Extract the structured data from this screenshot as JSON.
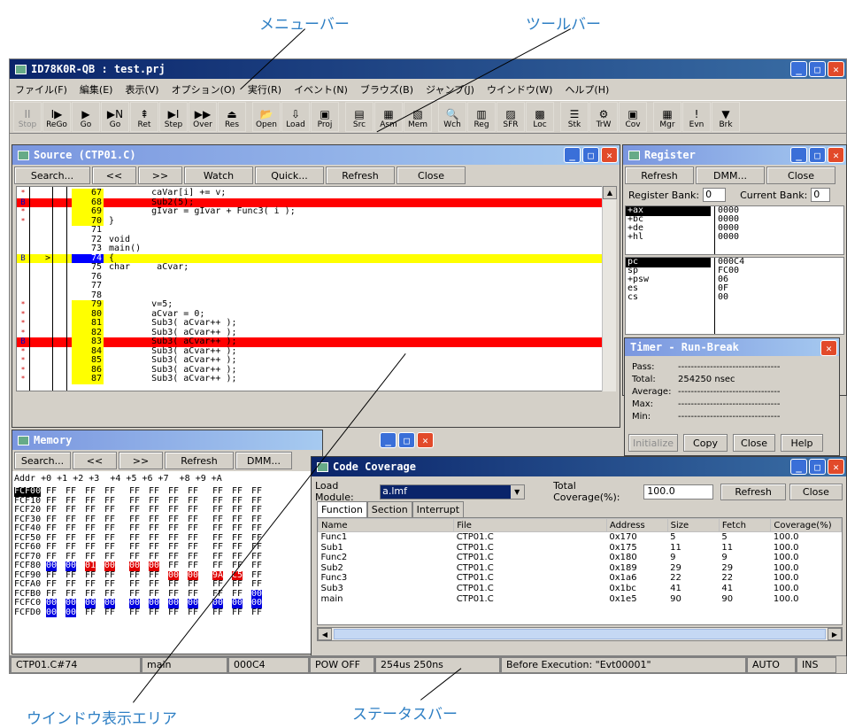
{
  "callouts": {
    "menubar": "メニューバー",
    "toolbar": "ツールバー",
    "window_area": "ウインドウ表示エリア",
    "statusbar": "ステータスバー"
  },
  "app": {
    "title": "ID78K0R-QB : test.prj"
  },
  "menu": [
    "ファイル(F)",
    "編集(E)",
    "表示(V)",
    "オプション(O)",
    "実行(R)",
    "イベント(N)",
    "ブラウズ(B)",
    "ジャンプ(J)",
    "ウインドウ(W)",
    "ヘルプ(H)"
  ],
  "toolbar": [
    {
      "label": "Stop",
      "icon": "stop-icon",
      "glyph": "II",
      "disabled": true
    },
    {
      "label": "ReGo",
      "icon": "rego-icon",
      "glyph": "I▶",
      "disabled": false
    },
    {
      "label": "Go",
      "icon": "go-icon",
      "glyph": "▶",
      "disabled": false
    },
    {
      "label": "Go",
      "icon": "go-n-icon",
      "glyph": "▶N",
      "disabled": false
    },
    {
      "label": "Ret",
      "icon": "ret-icon",
      "glyph": "⇞",
      "disabled": false
    },
    {
      "label": "Step",
      "icon": "step-icon",
      "glyph": "▶I",
      "disabled": false
    },
    {
      "label": "Over",
      "icon": "over-icon",
      "glyph": "▶▶",
      "disabled": false
    },
    {
      "label": "Res",
      "icon": "reset-icon",
      "glyph": "⏏",
      "disabled": false
    },
    {
      "sep": true
    },
    {
      "label": "Open",
      "icon": "open-icon",
      "glyph": "📂",
      "disabled": false
    },
    {
      "label": "Load",
      "icon": "load-icon",
      "glyph": "⇩",
      "disabled": false
    },
    {
      "label": "Proj",
      "icon": "project-icon",
      "glyph": "▣",
      "disabled": false
    },
    {
      "sep": true
    },
    {
      "label": "Src",
      "icon": "source-icon",
      "glyph": "▤",
      "disabled": false
    },
    {
      "label": "Asm",
      "icon": "asm-icon",
      "glyph": "▦",
      "disabled": false
    },
    {
      "label": "Mem",
      "icon": "memory-icon",
      "glyph": "▧",
      "disabled": false
    },
    {
      "sep": true
    },
    {
      "label": "Wch",
      "icon": "watch-icon",
      "glyph": "🔍",
      "disabled": false
    },
    {
      "label": "Reg",
      "icon": "register-icon",
      "glyph": "▥",
      "disabled": false
    },
    {
      "label": "SFR",
      "icon": "sfr-icon",
      "glyph": "▨",
      "disabled": false
    },
    {
      "label": "Loc",
      "icon": "local-icon",
      "glyph": "▩",
      "disabled": false
    },
    {
      "sep": true
    },
    {
      "label": "Stk",
      "icon": "stack-icon",
      "glyph": "☰",
      "disabled": false
    },
    {
      "label": "TrW",
      "icon": "trace-icon",
      "glyph": "⚙",
      "disabled": false
    },
    {
      "label": "Cov",
      "icon": "coverage-icon",
      "glyph": "▣",
      "disabled": false
    },
    {
      "sep": true
    },
    {
      "label": "Mgr",
      "icon": "manager-icon",
      "glyph": "▦",
      "disabled": false
    },
    {
      "label": "Evn",
      "icon": "event-icon",
      "glyph": "!",
      "disabled": false
    },
    {
      "label": "Brk",
      "icon": "break-icon",
      "glyph": "▼",
      "disabled": false
    }
  ],
  "source": {
    "title": "Source (CTP01.C)",
    "buttons": [
      "Search...",
      "<<",
      ">>",
      "Watch",
      "Quick...",
      "Refresh",
      "Close"
    ],
    "lines": [
      {
        "m": "*",
        "ln": "67",
        "text": "        caVar[i] += v;",
        "hl": "",
        "lnc": "yellow"
      },
      {
        "m": "B",
        "ln": "68",
        "text": "        Sub2(5);",
        "hl": "red",
        "lnc": "yellow"
      },
      {
        "m": "*",
        "ln": "69",
        "text": "        gIvar = gIvar + Func3( i );",
        "hl": "",
        "lnc": "yellow"
      },
      {
        "m": "*",
        "ln": "70",
        "text": "}",
        "hl": "",
        "lnc": "yellow"
      },
      {
        "m": "",
        "ln": "71",
        "text": "",
        "hl": "",
        "lnc": ""
      },
      {
        "m": "",
        "ln": "72",
        "text": "void",
        "hl": "",
        "lnc": ""
      },
      {
        "m": "",
        "ln": "73",
        "text": "main()",
        "hl": "",
        "lnc": ""
      },
      {
        "m": "B",
        "ln": "74",
        "text": "{",
        "hl": "yellow",
        "lnc": "blue",
        "arrow": ">"
      },
      {
        "m": "",
        "ln": "75",
        "text": "char     aCvar;",
        "hl": "",
        "lnc": ""
      },
      {
        "m": "",
        "ln": "76",
        "text": "",
        "hl": "",
        "lnc": ""
      },
      {
        "m": "",
        "ln": "77",
        "text": "",
        "hl": "",
        "lnc": ""
      },
      {
        "m": "",
        "ln": "78",
        "text": "",
        "hl": "",
        "lnc": ""
      },
      {
        "m": "*",
        "ln": "79",
        "text": "        v=5;",
        "hl": "",
        "lnc": "yellow"
      },
      {
        "m": "*",
        "ln": "80",
        "text": "        aCvar = 0;",
        "hl": "",
        "lnc": "yellow"
      },
      {
        "m": "*",
        "ln": "81",
        "text": "        Sub3( aCvar++ );",
        "hl": "",
        "lnc": "yellow"
      },
      {
        "m": "*",
        "ln": "82",
        "text": "        Sub3( aCvar++ );",
        "hl": "",
        "lnc": "yellow"
      },
      {
        "m": "B",
        "ln": "83",
        "text": "        Sub3( aCvar++ );",
        "hl": "red",
        "lnc": "yellow"
      },
      {
        "m": "*",
        "ln": "84",
        "text": "        Sub3( aCvar++ );",
        "hl": "",
        "lnc": "yellow"
      },
      {
        "m": "*",
        "ln": "85",
        "text": "        Sub3( aCvar++ );",
        "hl": "",
        "lnc": "yellow"
      },
      {
        "m": "*",
        "ln": "86",
        "text": "        Sub3( aCvar++ );",
        "hl": "",
        "lnc": "yellow"
      },
      {
        "m": "*",
        "ln": "87",
        "text": "        Sub3( aCvar++ );",
        "hl": "",
        "lnc": "yellow"
      }
    ]
  },
  "register": {
    "title": "Register",
    "buttons": [
      "Refresh",
      "DMM...",
      "Close"
    ],
    "bank_label": "Register Bank:",
    "bank_value": "0",
    "current_label": "Current Bank:",
    "current_value": "0",
    "group1": [
      {
        "n": "+ax",
        "v": "0000",
        "sel": true
      },
      {
        "n": "+bc",
        "v": "0000"
      },
      {
        "n": "+de",
        "v": "0000"
      },
      {
        "n": "+hl",
        "v": "0000"
      }
    ],
    "group2": [
      {
        "n": "pc",
        "v": "000C4",
        "sel": true
      },
      {
        "n": "sp",
        "v": "FC00"
      },
      {
        "n": "+psw",
        "v": "06"
      },
      {
        "n": "es",
        "v": "0F"
      },
      {
        "n": "cs",
        "v": "00"
      }
    ]
  },
  "timer": {
    "title": "Timer - Run-Break",
    "rows": [
      {
        "k": "Pass:",
        "v": "--------------------------------"
      },
      {
        "k": "Total:",
        "v": "254250 nsec"
      },
      {
        "k": "Average:",
        "v": "--------------------------------"
      },
      {
        "k": "Max:",
        "v": "--------------------------------"
      },
      {
        "k": "Min:",
        "v": "--------------------------------"
      }
    ],
    "buttons": [
      "Initialize",
      "Copy",
      "Close",
      "Help"
    ]
  },
  "memory": {
    "title": "Memory",
    "buttons": [
      "Search...",
      "<<",
      ">>",
      "Refresh",
      "DMM..."
    ],
    "header": "Addr +0 +1 +2 +3  +4 +5 +6 +7  +8 +9 +A",
    "rows": [
      {
        "a": "FCF00",
        "c": [
          "FF",
          "FF",
          "FF",
          "FF",
          "FF",
          "FF",
          "FF",
          "FF",
          "FF",
          "FF",
          "FF"
        ],
        "sel": true
      },
      {
        "a": "FCF10",
        "c": [
          "FF",
          "FF",
          "FF",
          "FF",
          "FF",
          "FF",
          "FF",
          "FF",
          "FF",
          "FF",
          "FF"
        ]
      },
      {
        "a": "FCF20",
        "c": [
          "FF",
          "FF",
          "FF",
          "FF",
          "FF",
          "FF",
          "FF",
          "FF",
          "FF",
          "FF",
          "FF"
        ]
      },
      {
        "a": "FCF30",
        "c": [
          "FF",
          "FF",
          "FF",
          "FF",
          "FF",
          "FF",
          "FF",
          "FF",
          "FF",
          "FF",
          "FF"
        ]
      },
      {
        "a": "FCF40",
        "c": [
          "FF",
          "FF",
          "FF",
          "FF",
          "FF",
          "FF",
          "FF",
          "FF",
          "FF",
          "FF",
          "FF"
        ]
      },
      {
        "a": "FCF50",
        "c": [
          "FF",
          "FF",
          "FF",
          "FF",
          "FF",
          "FF",
          "FF",
          "FF",
          "FF",
          "FF",
          "FF"
        ]
      },
      {
        "a": "FCF60",
        "c": [
          "FF",
          "FF",
          "FF",
          "FF",
          "FF",
          "FF",
          "FF",
          "FF",
          "FF",
          "FF",
          "FF"
        ]
      },
      {
        "a": "FCF70",
        "c": [
          "FF",
          "FF",
          "FF",
          "FF",
          "FF",
          "FF",
          "FF",
          "FF",
          "FF",
          "FF",
          "FF"
        ]
      },
      {
        "a": "FCF80",
        "c": [
          "00",
          "00",
          "01",
          "00",
          "00",
          "00",
          "FF",
          "FF",
          "FF",
          "FF",
          "FF"
        ],
        "hl": [
          "b",
          "b",
          "r",
          "r",
          "r",
          "r",
          "",
          "",
          "",
          "",
          ""
        ]
      },
      {
        "a": "FCF90",
        "c": [
          "FF",
          "FF",
          "FF",
          "FF",
          "FF",
          "FF",
          "00",
          "00",
          "9A",
          "C5",
          "FF"
        ],
        "hl": [
          "",
          "",
          "",
          "",
          "",
          "",
          "r",
          "r",
          "r",
          "r",
          ""
        ]
      },
      {
        "a": "FCFA0",
        "c": [
          "FF",
          "FF",
          "FF",
          "FF",
          "FF",
          "FF",
          "FF",
          "FF",
          "FF",
          "FF",
          "FF"
        ]
      },
      {
        "a": "FCFB0",
        "c": [
          "FF",
          "FF",
          "FF",
          "FF",
          "FF",
          "FF",
          "FF",
          "FF",
          "FF",
          "FF",
          "00"
        ],
        "hl": [
          "",
          "",
          "",
          "",
          "",
          "",
          "",
          "",
          "",
          "",
          "b"
        ]
      },
      {
        "a": "FCFC0",
        "c": [
          "00",
          "00",
          "00",
          "00",
          "00",
          "00",
          "00",
          "00",
          "00",
          "00",
          "00"
        ],
        "hl": [
          "b",
          "b",
          "b",
          "b",
          "b",
          "b",
          "b",
          "b",
          "b",
          "b",
          "b"
        ]
      },
      {
        "a": "FCFD0",
        "c": [
          "00",
          "00",
          "FF",
          "FF",
          "FF",
          "FF",
          "FF",
          "FF",
          "FF",
          "FF",
          "FF"
        ],
        "hl": [
          "b",
          "b",
          "",
          "",
          "",
          "",
          "",
          "",
          "",
          "",
          ""
        ]
      }
    ]
  },
  "coverage": {
    "title": "Code Coverage",
    "module_label": "Load Module:",
    "module_value": "a.lmf",
    "total_label": "Total Coverage(%):",
    "total_value": "100.0",
    "buttons": [
      "Refresh",
      "Close"
    ],
    "tabs": [
      "Function",
      "Section",
      "Interrupt"
    ],
    "columns": [
      "Name",
      "File",
      "Address",
      "Size",
      "Fetch",
      "Coverage(%)"
    ],
    "rows": [
      [
        "Func1",
        "CTP01.C",
        "0x170",
        "5",
        "5",
        "100.0"
      ],
      [
        "Sub1",
        "CTP01.C",
        "0x175",
        "11",
        "11",
        "100.0"
      ],
      [
        "Func2",
        "CTP01.C",
        "0x180",
        "9",
        "9",
        "100.0"
      ],
      [
        "Sub2",
        "CTP01.C",
        "0x189",
        "29",
        "29",
        "100.0"
      ],
      [
        "Func3",
        "CTP01.C",
        "0x1a6",
        "22",
        "22",
        "100.0"
      ],
      [
        "Sub3",
        "CTP01.C",
        "0x1bc",
        "41",
        "41",
        "100.0"
      ],
      [
        "main",
        "CTP01.C",
        "0x1e5",
        "90",
        "90",
        "100.0"
      ]
    ]
  },
  "status": [
    {
      "t": "CTP01.C#74",
      "w": 148
    },
    {
      "t": "main",
      "w": 98
    },
    {
      "t": "000C4",
      "w": 92
    },
    {
      "t": "POW OFF",
      "w": 74
    },
    {
      "t": "254us 250ns",
      "w": 142
    },
    {
      "t": "Before Execution: \"Evt00001\"",
      "w": 278
    },
    {
      "t": "AUTO",
      "w": 56
    },
    {
      "t": "INS",
      "w": 46
    }
  ]
}
